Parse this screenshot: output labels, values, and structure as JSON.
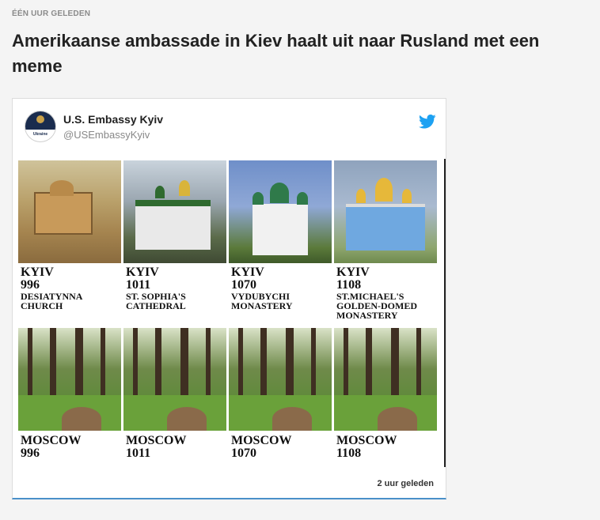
{
  "article": {
    "timestamp": "ÉÉN UUR GELEDEN",
    "headline": "Amerikaanse ambassade in Kiev haalt uit naar Rusland met een meme"
  },
  "tweet": {
    "account_name": "U.S. Embassy Kyiv",
    "handle": "@USEmbassyKyiv",
    "avatar_text": "U.S. EMBASSY",
    "avatar_label": "Ukraine",
    "time": "2 uur geleden",
    "brand_color": "#1da1f2",
    "kyiv": [
      {
        "city": "KYIV",
        "year": "996",
        "l1": "DESIATYNNA",
        "l2": "CHURCH",
        "l3": ""
      },
      {
        "city": "KYIV",
        "year": "1011",
        "l1": "ST. SOPHIA'S",
        "l2": "CATHEDRAL",
        "l3": ""
      },
      {
        "city": "KYIV",
        "year": "1070",
        "l1": "VYDUBYCHI",
        "l2": "MONASTERY",
        "l3": ""
      },
      {
        "city": "KYIV",
        "year": "1108",
        "l1": "ST.MICHAEL'S",
        "l2": "GOLDEN-DOMED",
        "l3": "MONASTERY"
      }
    ],
    "moscow": [
      {
        "city": "MOSCOW",
        "year": "996"
      },
      {
        "city": "MOSCOW",
        "year": "1011"
      },
      {
        "city": "MOSCOW",
        "year": "1070"
      },
      {
        "city": "MOSCOW",
        "year": "1108"
      }
    ]
  }
}
